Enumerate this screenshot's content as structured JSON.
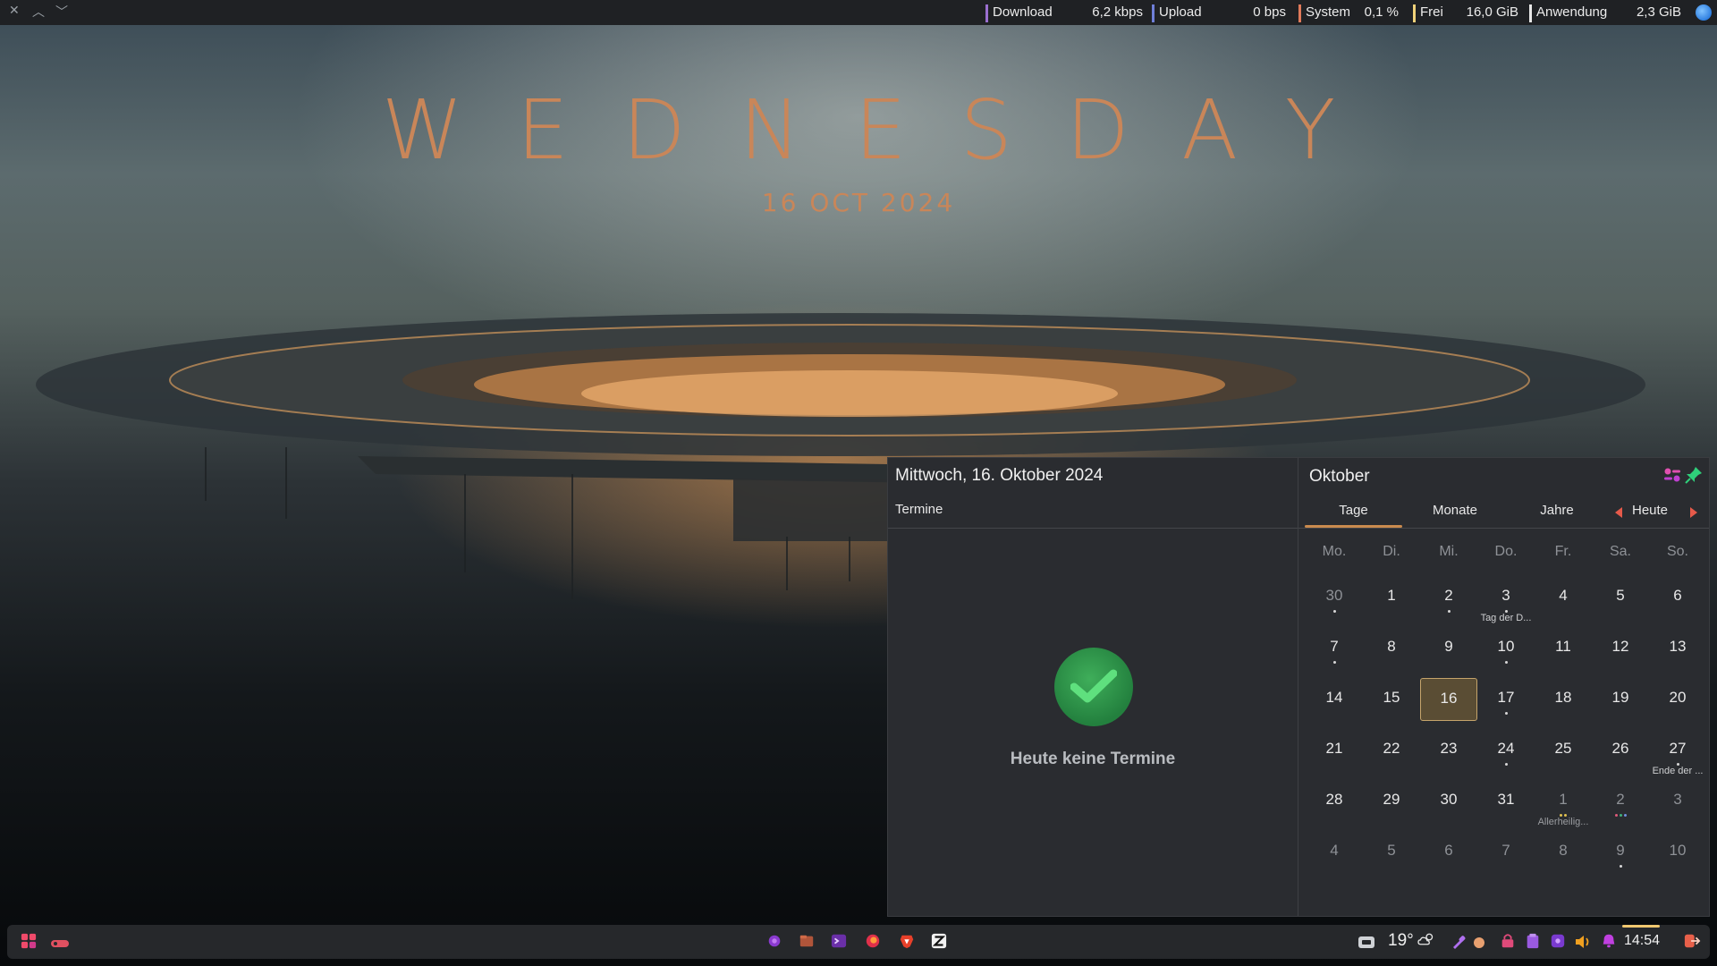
{
  "wallpaper": {
    "title": "WEDNESDAY",
    "date": "16 OCT 2024"
  },
  "topbar": {
    "window_controls": [
      "close-icon",
      "chevron-up-icon",
      "chevron-down-icon"
    ],
    "monitors": [
      {
        "label": "Download",
        "value": "6,2 kbps",
        "color": "#9b6fd0"
      },
      {
        "label": "Upload",
        "value": "0 bps",
        "color": "#6f7fd8"
      },
      {
        "label": "System",
        "value": "0,1 %",
        "color": "#e07a5a"
      },
      {
        "label": "Frei",
        "value": "16,0 GiB",
        "color": "#f0d27a"
      },
      {
        "label": "Anwendung",
        "value": "2,3 GiB",
        "color": "#e8e8e8"
      }
    ]
  },
  "calendar": {
    "date_heading": "Mittwoch, 16. Oktober 2024",
    "agenda_label": "Termine",
    "empty_text": "Heute keine Termine",
    "month_title": "Oktober",
    "tabs": [
      "Tage",
      "Monate",
      "Jahre"
    ],
    "today_label": "Heute",
    "weekdays": [
      "Mo.",
      "Di.",
      "Mi.",
      "Do.",
      "Fr.",
      "Sa.",
      "So."
    ],
    "weeks": [
      [
        {
          "d": "30",
          "other": true,
          "dots": [
            "#d8d8d8"
          ]
        },
        {
          "d": "1"
        },
        {
          "d": "2",
          "dots": [
            "#d8d8d8"
          ]
        },
        {
          "d": "3",
          "dots": [
            "#d8d8d8"
          ],
          "event": "Tag der D..."
        },
        {
          "d": "4"
        },
        {
          "d": "5"
        },
        {
          "d": "6"
        }
      ],
      [
        {
          "d": "7",
          "dots": [
            "#d8d8d8"
          ]
        },
        {
          "d": "8"
        },
        {
          "d": "9"
        },
        {
          "d": "10",
          "dots": [
            "#d8d8d8"
          ]
        },
        {
          "d": "11"
        },
        {
          "d": "12"
        },
        {
          "d": "13"
        }
      ],
      [
        {
          "d": "14"
        },
        {
          "d": "15"
        },
        {
          "d": "16",
          "today": true
        },
        {
          "d": "17",
          "dots": [
            "#d8d8d8"
          ]
        },
        {
          "d": "18"
        },
        {
          "d": "19"
        },
        {
          "d": "20"
        }
      ],
      [
        {
          "d": "21"
        },
        {
          "d": "22"
        },
        {
          "d": "23"
        },
        {
          "d": "24",
          "dots": [
            "#d8d8d8"
          ]
        },
        {
          "d": "25"
        },
        {
          "d": "26"
        },
        {
          "d": "27",
          "dots": [
            "#d8d8d8"
          ],
          "event": "Ende der ..."
        }
      ],
      [
        {
          "d": "28"
        },
        {
          "d": "29"
        },
        {
          "d": "30"
        },
        {
          "d": "31"
        },
        {
          "d": "1",
          "other": true,
          "dots": [
            "#e0c050",
            "#e0c050"
          ],
          "event": "Allerheilig..."
        },
        {
          "d": "2",
          "other": true,
          "dots": [
            "#e05a7a",
            "#3fb07a",
            "#6f8fe0"
          ]
        },
        {
          "d": "3",
          "other": true
        }
      ],
      [
        {
          "d": "4",
          "other": true
        },
        {
          "d": "5",
          "other": true
        },
        {
          "d": "6",
          "other": true
        },
        {
          "d": "7",
          "other": true
        },
        {
          "d": "8",
          "other": true
        },
        {
          "d": "9",
          "other": true,
          "dots": [
            "#d8d8d8"
          ]
        },
        {
          "d": "10",
          "other": true
        }
      ]
    ]
  },
  "panel": {
    "temperature": "19°",
    "clock": "14:54",
    "taskbar_icons": [
      "app-icon-purple-spiral",
      "files-icon",
      "terminal-icon",
      "firefox-icon",
      "brave-icon",
      "zed-editor-icon"
    ],
    "tray_icons": [
      "weather-widget-icon",
      "partly-cloudy-icon",
      "color-picker-icon",
      "record-icon",
      "vault-icon",
      "clipboard-icon",
      "app-icon-purple",
      "volume-icon",
      "notification-icon",
      "logout-icon"
    ]
  }
}
